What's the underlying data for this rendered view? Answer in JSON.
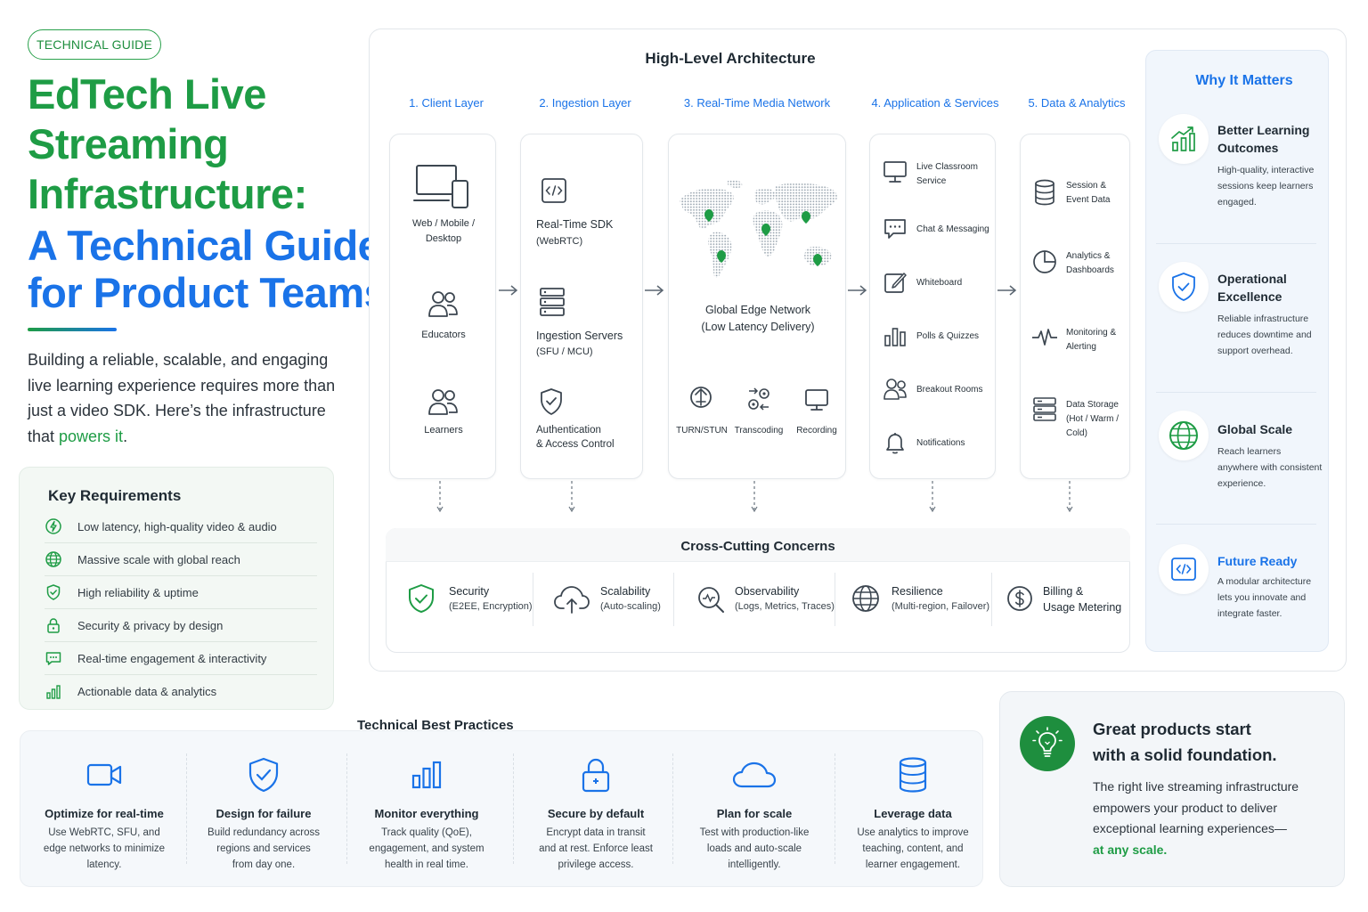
{
  "header": {
    "badge": "TECHNICAL GUIDE",
    "title_line1": "EdTech Live",
    "title_line2": "Streaming",
    "title_line3": "Infrastructure:",
    "title_line4": "A Technical Guide",
    "title_line5": "for Product Teams",
    "intro": "Building a reliable, scalable, and engaging live learning experience requires more than just a video SDK. Here’s the infrastructure that ",
    "intro_highlight": "powers it",
    "intro_end": "."
  },
  "requirements": {
    "title": "Key Requirements",
    "items": [
      {
        "icon": "lightning-icon",
        "label": "Low latency, high-quality video & audio"
      },
      {
        "icon": "globe-icon",
        "label": "Massive scale with global reach"
      },
      {
        "icon": "shield-check-icon",
        "label": "High reliability & uptime"
      },
      {
        "icon": "lock-icon",
        "label": "Security & privacy by design"
      },
      {
        "icon": "chat-icon",
        "label": "Real-time engagement & interactivity"
      },
      {
        "icon": "bar-chart-icon",
        "label": "Actionable data & analytics"
      }
    ]
  },
  "architecture": {
    "title": "High-Level Architecture",
    "layers": {
      "client": {
        "header": "1. Client Layer",
        "devices": "Web / Mobile /",
        "devices2": "Desktop",
        "educators": "Educators",
        "learners": "Learners"
      },
      "ingestion": {
        "header": "2. Ingestion Layer",
        "sdk": "Real-Time SDK",
        "sdk_sub": "(WebRTC)",
        "servers": "Ingestion Servers",
        "servers_sub": "(SFU / MCU)",
        "auth": "Authentication",
        "auth2": "& Access Control"
      },
      "media": {
        "header": "3. Real-Time Media Network",
        "edge": "Global Edge Network",
        "edge_sub": "(Low Latency Delivery)",
        "turn": "TURN/STUN",
        "transcoding": "Transcoding",
        "recording": "Recording"
      },
      "app": {
        "header": "4. Application & Services",
        "live1": "Live Classroom",
        "live2": "Service",
        "chat": "Chat & Messaging",
        "whiteboard": "Whiteboard",
        "polls": "Polls & Quizzes",
        "breakout": "Breakout Rooms",
        "notifications": "Notifications"
      },
      "data": {
        "header": "5. Data & Analytics",
        "session1": "Session &",
        "session2": "Event Data",
        "analytics1": "Analytics &",
        "analytics2": "Dashboards",
        "monitoring1": "Monitoring &",
        "monitoring2": "Alerting",
        "storage1": "Data Storage",
        "storage2": "(Hot / Warm /",
        "storage3": "Cold)"
      }
    },
    "cross_cutting": {
      "title": "Cross-Cutting Concerns",
      "items": [
        {
          "icon": "shield-check-icon",
          "name": "Security",
          "sub": "(E2EE, Encryption)"
        },
        {
          "icon": "cloud-upload-icon",
          "name": "Scalability",
          "sub": "(Auto-scaling)"
        },
        {
          "icon": "magnifier-icon",
          "name": "Observability",
          "sub": "(Logs, Metrics, Traces)"
        },
        {
          "icon": "globe-icon",
          "name": "Resilience",
          "sub": "(Multi-region, Failover)"
        },
        {
          "icon": "dollar-icon",
          "name": "Billing &",
          "sub": "Usage Metering"
        }
      ]
    }
  },
  "why": {
    "title": "Why It Matters",
    "items": [
      {
        "icon": "growth-chart-icon",
        "title1": "Better Learning",
        "title2": "Outcomes",
        "d1": "High-quality, interactive",
        "d2": "sessions keep learners",
        "d3": "engaged."
      },
      {
        "icon": "shield-check-icon",
        "title1": "Operational",
        "title2": "Excellence",
        "d1": "Reliable infrastructure",
        "d2": "reduces downtime and",
        "d3": "support overhead."
      },
      {
        "icon": "globe-icon",
        "title1": "Global Scale",
        "title2": "",
        "d1": "Reach learners",
        "d2": "anywhere with consistent",
        "d3": "experience."
      },
      {
        "icon": "code-icon",
        "title1": "Future Ready",
        "title2": "",
        "d1": "A modular architecture",
        "d2": "lets you innovate and",
        "d3": "integrate faster."
      }
    ]
  },
  "best_practices": {
    "title": "Technical Best Practices",
    "items": [
      {
        "icon": "video-camera-icon",
        "title": "Optimize for real-time",
        "d1": "Use WebRTC, SFU, and",
        "d2": "edge networks to minimize",
        "d3": "latency."
      },
      {
        "icon": "shield-check-icon",
        "title": "Design for failure",
        "d1": "Build redundancy across",
        "d2": "regions and services",
        "d3": "from day one."
      },
      {
        "icon": "bar-chart-icon",
        "title": "Monitor everything",
        "d1": "Track quality (QoE),",
        "d2": "engagement, and system",
        "d3": "health in real time."
      },
      {
        "icon": "lock-icon",
        "title": "Secure by default",
        "d1": "Encrypt data in transit",
        "d2": "and at rest. Enforce least",
        "d3": "privilege access."
      },
      {
        "icon": "cloud-icon",
        "title": "Plan for scale",
        "d1": "Test with production-like",
        "d2": "loads and auto-scale",
        "d3": "intelligently."
      },
      {
        "icon": "database-icon",
        "title": "Leverage data",
        "d1": "Use analytics to improve",
        "d2": "teaching, content, and",
        "d3": "learner engagement."
      }
    ]
  },
  "cta": {
    "title1": "Great products start",
    "title2": "with a solid foundation.",
    "body": "The right live streaming infrastructure empowers your product to deliver exceptional learning experiences—",
    "highlight": "at any scale."
  },
  "colors": {
    "green": "#1e9c45",
    "blue": "#1a73e8",
    "text": "#1f2a33"
  }
}
